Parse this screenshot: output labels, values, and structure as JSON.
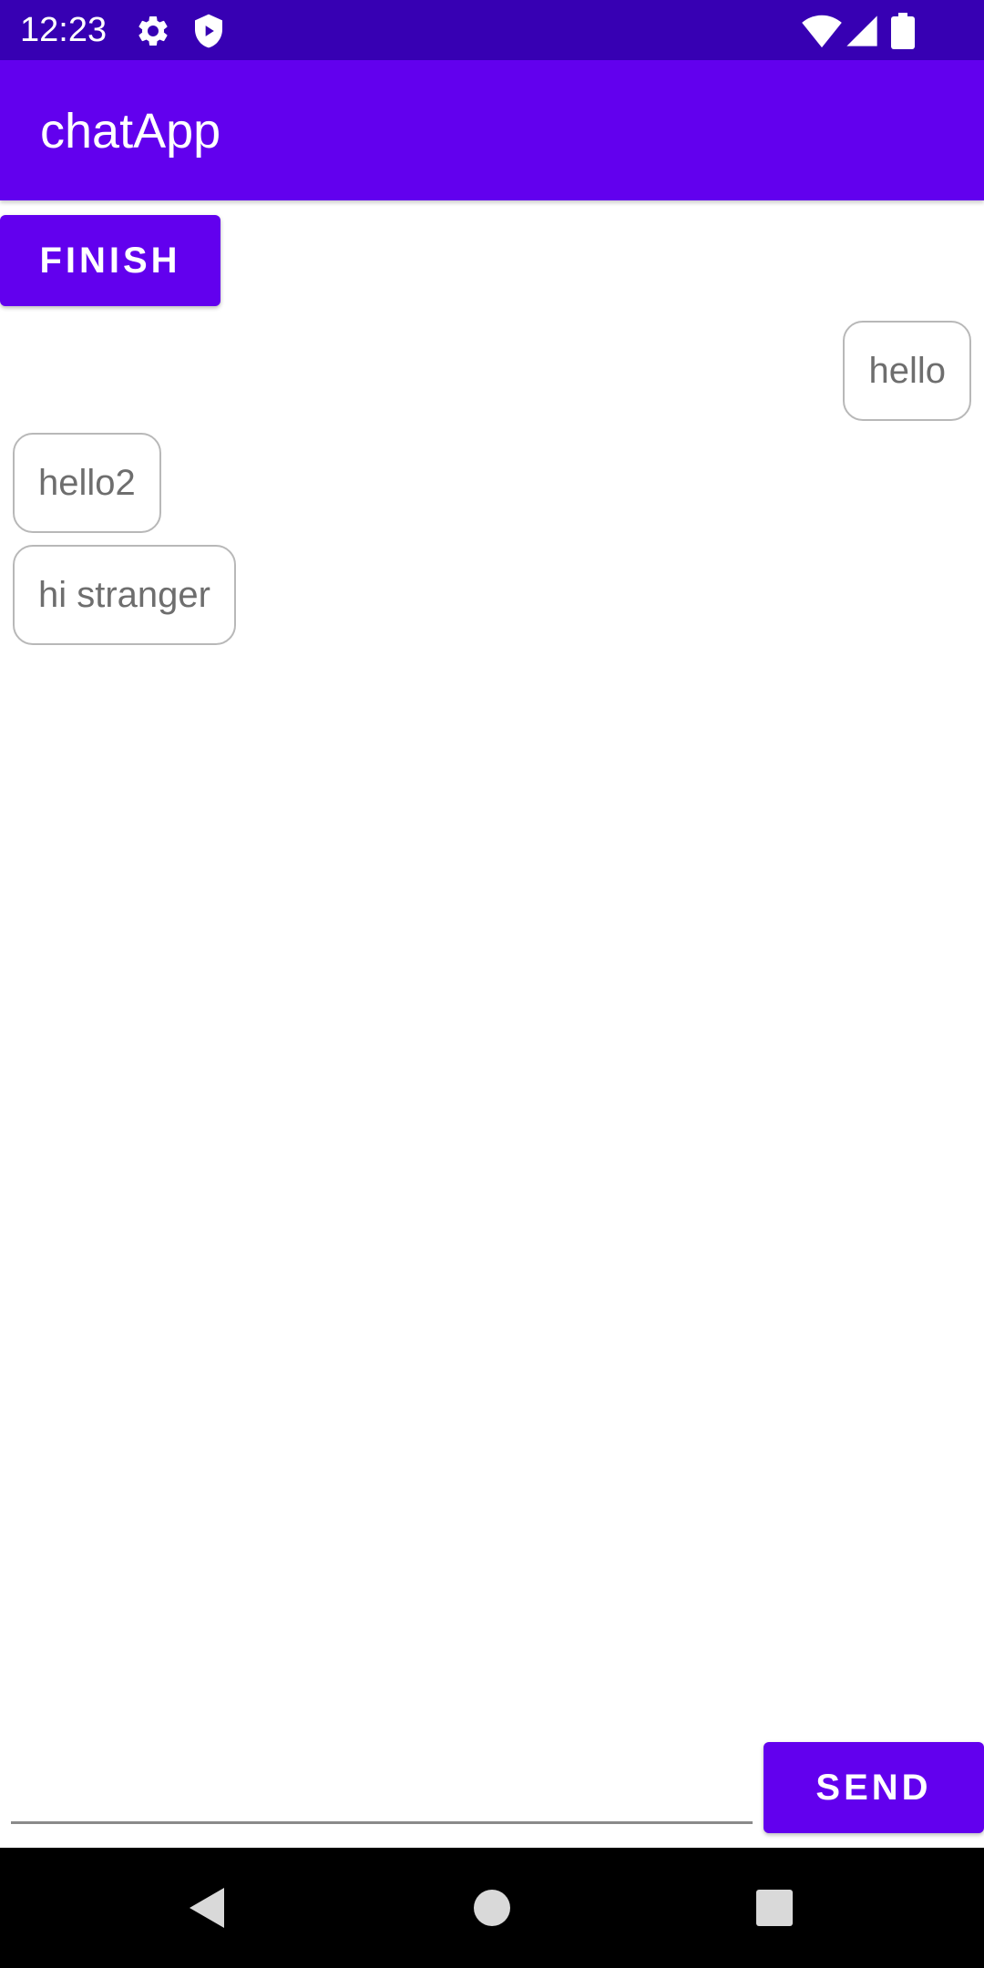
{
  "status_bar": {
    "time": "12:23",
    "icons": [
      "gear-icon",
      "shield-icon",
      "wifi-icon",
      "signal-icon",
      "battery-icon"
    ]
  },
  "app_bar": {
    "title": "chatApp",
    "color": "#6200ee"
  },
  "finish_button": {
    "label": "FINISH"
  },
  "messages": [
    {
      "text": "hello",
      "align": "right"
    },
    {
      "text": "hello2",
      "align": "left"
    },
    {
      "text": "hi stranger",
      "align": "left"
    }
  ],
  "composer": {
    "value": "",
    "send_label": "SEND"
  },
  "nav_bar": {
    "icons": [
      "back-icon",
      "home-icon",
      "recents-icon"
    ]
  },
  "colors": {
    "primary": "#6200ee",
    "primary_dark": "#3700b3"
  }
}
